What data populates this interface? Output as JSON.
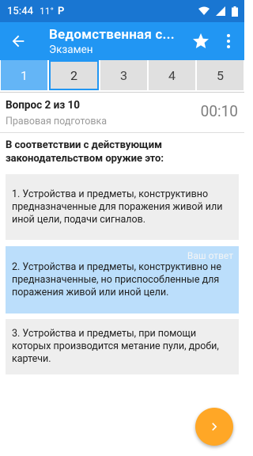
{
  "status_bar": {
    "time": "15:44",
    "temperature": "11°",
    "app_icon": "P"
  },
  "app_bar": {
    "title": "Ведомственная с...",
    "subtitle": "Экзамен"
  },
  "tabs": [
    {
      "label": "1",
      "state": "answered"
    },
    {
      "label": "2",
      "state": "current"
    },
    {
      "label": "3",
      "state": "pending"
    },
    {
      "label": "4",
      "state": "pending"
    },
    {
      "label": "5",
      "state": "pending"
    }
  ],
  "question_header": {
    "counter": "Вопрос 2 из 10",
    "category": "Правовая подготовка",
    "timer": "00:10"
  },
  "question": {
    "text": "В соответствии с действующим законодательством оружие это:"
  },
  "answers": [
    {
      "text": "1. Устройства и предметы, конструктивно предназначенные для поражения живой или иной цели, подачи сигналов."
    },
    {
      "text": "2. Устройства и предметы, конструктивно не предназначенные, но приспособленные для поражения живой или иной цели.",
      "badge": "Ваш ответ"
    },
    {
      "text": "3. Устройства и предметы, при помощи которых производится метание пули, дроби, картечи."
    }
  ],
  "colors": {
    "status_bar": "#1976d2",
    "app_bar": "#2196f3",
    "tab_done": "#64b5f6",
    "tab_pending": "#e0e0e0",
    "selected_answer": "#bbdefb",
    "fab": "#ffa726"
  }
}
